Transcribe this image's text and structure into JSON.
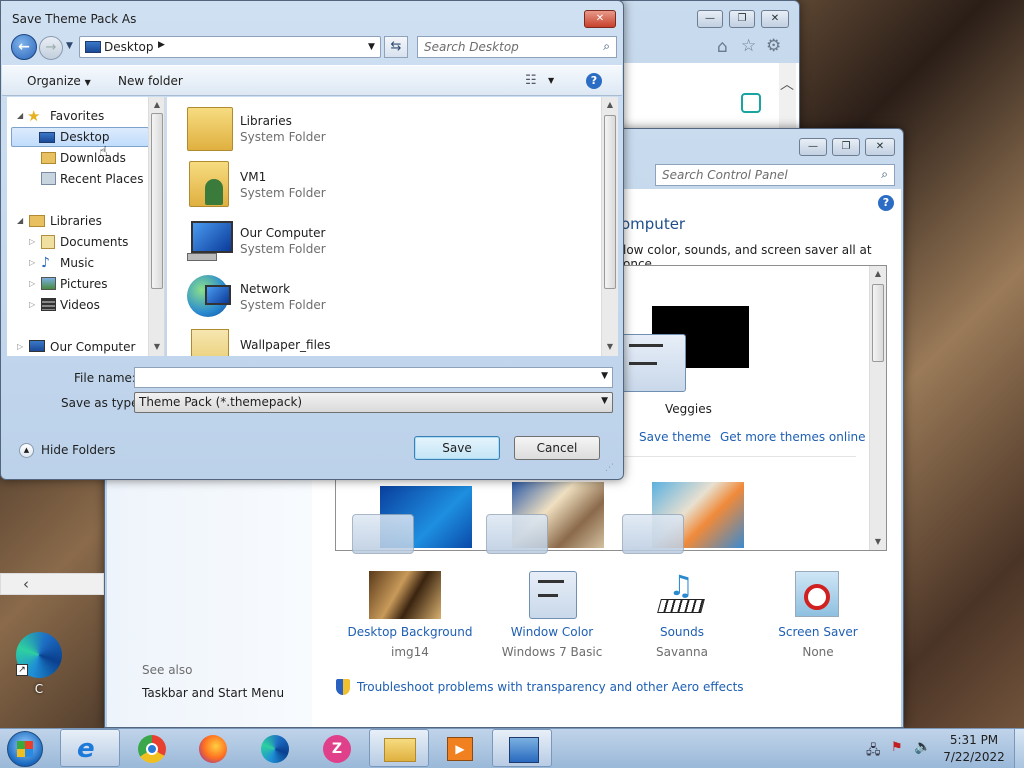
{
  "back_window": {
    "title_buttons": [
      "—",
      "❐",
      "✕"
    ]
  },
  "control_panel": {
    "search_placeholder": "Search Control Panel",
    "heading_fragment": "omputer",
    "subtitle_fragment": "low color, sounds, and screen saver all at once.",
    "selected_theme": "Veggies",
    "save_theme": "Save theme",
    "get_more": "Get more themes online",
    "bottom_items": [
      {
        "label": "Desktop Background",
        "value": "img14"
      },
      {
        "label": "Window Color",
        "value": "Windows 7 Basic"
      },
      {
        "label": "Sounds",
        "value": "Savanna"
      },
      {
        "label": "Screen Saver",
        "value": "None"
      }
    ],
    "see_also": "See also",
    "taskbar_link": "Taskbar and Start Menu",
    "troubleshoot": "Troubleshoot problems with transparency and other Aero effects"
  },
  "dialog": {
    "title": "Save Theme Pack As",
    "address": "Desktop",
    "search_placeholder": "Search Desktop",
    "organize": "Organize",
    "new_folder": "New folder",
    "nav": {
      "favorites": "Favorites",
      "desktop": "Desktop",
      "downloads": "Downloads",
      "recent": "Recent Places",
      "libraries": "Libraries",
      "documents": "Documents",
      "music": "Music",
      "pictures": "Pictures",
      "videos": "Videos",
      "our_computer": "Our Computer"
    },
    "files": [
      {
        "name": "Libraries",
        "type": "System Folder"
      },
      {
        "name": "VM1",
        "type": "System Folder"
      },
      {
        "name": "Our Computer",
        "type": "System Folder"
      },
      {
        "name": "Network",
        "type": "System Folder"
      },
      {
        "name": "Wallpaper_files",
        "type": ""
      }
    ],
    "file_name_label": "File name:",
    "file_name_value": "",
    "save_as_label": "Save as type:",
    "save_as_value": "Theme Pack (*.themepack)",
    "hide_folders": "Hide Folders",
    "save": "Save",
    "cancel": "Cancel"
  },
  "desktop_icon_label": "C",
  "taskbar": {
    "time": "5:31 PM",
    "date": "7/22/2022"
  }
}
